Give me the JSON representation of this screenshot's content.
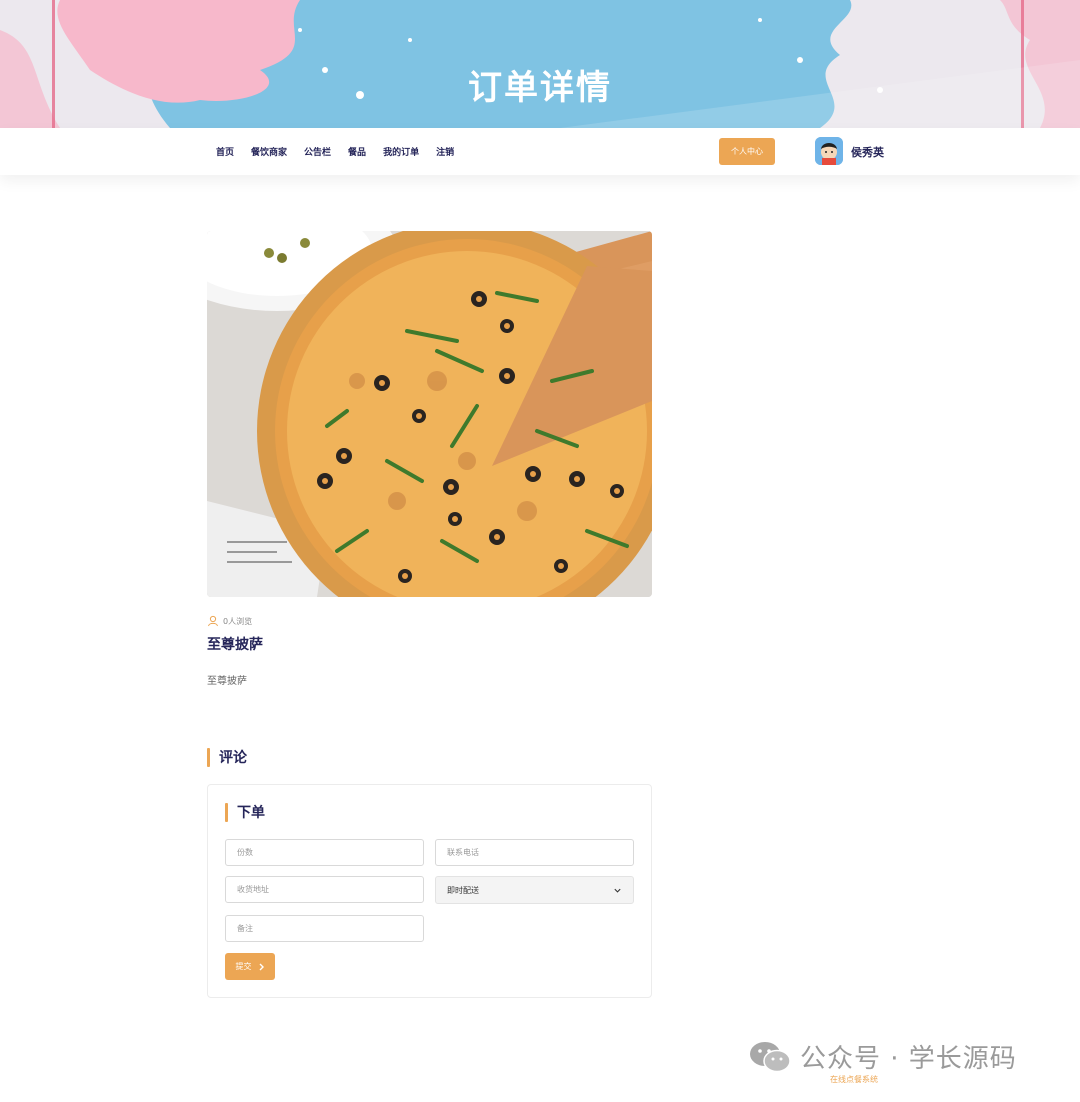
{
  "banner": {
    "title": "订单详情"
  },
  "nav": {
    "links": [
      "首页",
      "餐饮商家",
      "公告栏",
      "餐品",
      "我的订单",
      "注销"
    ],
    "center_button": "个人中心",
    "username": "侯秀英"
  },
  "product": {
    "views": "0人浏览",
    "title": "至尊披萨",
    "description": "至尊披萨"
  },
  "comments": {
    "heading": "评论"
  },
  "order": {
    "heading": "下单",
    "quantity_placeholder": "份数",
    "phone_placeholder": "联系电话",
    "address_placeholder": "收货地址",
    "delivery_selected": "即时配送",
    "note_placeholder": "备注",
    "submit_label": "提交"
  },
  "watermark": {
    "text": "公众号 · 学长源码",
    "subtext": "在线点餐系统"
  },
  "colors": {
    "accent": "#eca654",
    "navy": "#26265a",
    "banner_blue": "#7fc3e3",
    "banner_pink": "#f7b8cb"
  },
  "icons": {
    "views": "user-icon",
    "select": "chevron-down-icon",
    "submit": "chevron-right-icon",
    "watermark": "wechat-icon"
  }
}
